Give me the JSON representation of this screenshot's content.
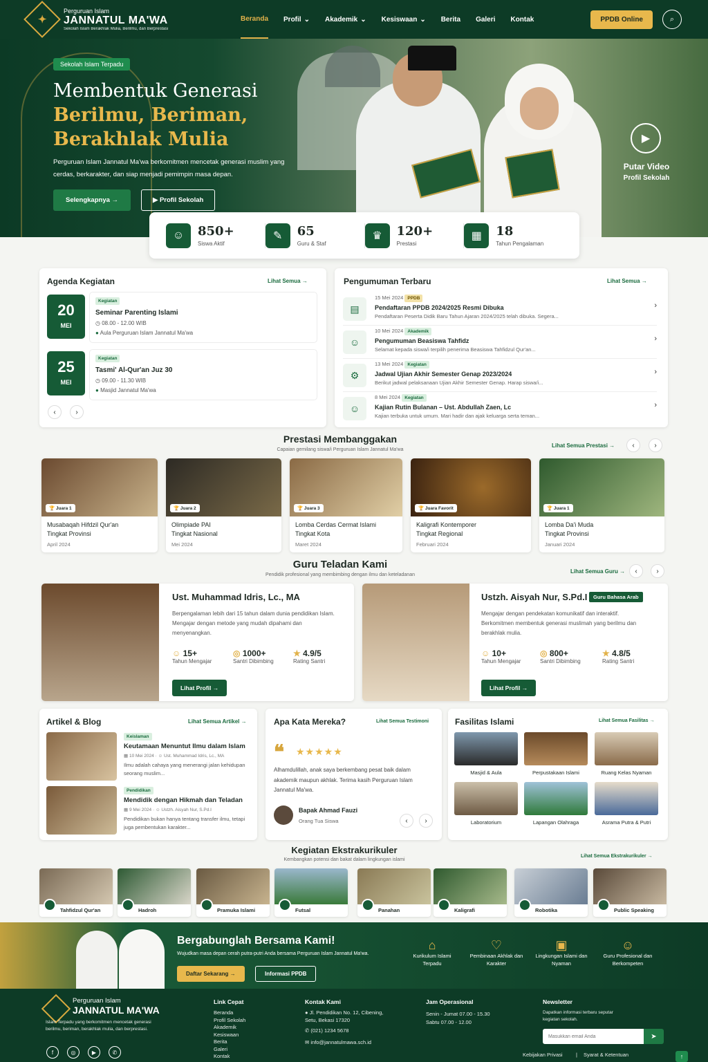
{
  "header": {
    "brand_top": "Perguruan Islam",
    "brand_name": "JANNATUL MA'WA",
    "brand_tagline": "Sekolah Islam Berakhlak Mulia, Berilmu, dan Berprestasi",
    "nav": [
      "Beranda",
      "Profil",
      "Akademik",
      "Kesiswaan",
      "Berita",
      "Galeri",
      "Kontak"
    ],
    "cta": "PPDB Online"
  },
  "hero": {
    "tag": "Sekolah Islam Terpadu",
    "line1": "Membentuk Generasi",
    "line2": "Berilmu, Beriman,",
    "line3": "Berakhlak Mulia",
    "desc": "Perguruan Islam Jannatul Ma'wa berkomitmen mencetak generasi muslim yang cerdas, berkarakter, dan siap menjadi pemimpin masa depan.",
    "btn_primary": "Selengkapnya",
    "btn_secondary": "Profil Sekolah",
    "video_title": "Putar Video",
    "video_sub": "Profil Sekolah"
  },
  "stats": [
    {
      "value": "850+",
      "label": "Siswa Aktif"
    },
    {
      "value": "65",
      "label": "Guru & Staf"
    },
    {
      "value": "120+",
      "label": "Prestasi"
    },
    {
      "value": "18",
      "label": "Tahun Pengalaman"
    }
  ],
  "agenda": {
    "title": "Agenda Kegiatan",
    "more": "Lihat Semua",
    "items": [
      {
        "day": "20",
        "month": "MEI",
        "badge": "Kegiatan",
        "title": "Seminar Parenting Islami",
        "time": "08.00 - 12.00 WIB",
        "place": "Aula Perguruan Islam Jannatul Ma'wa"
      },
      {
        "day": "25",
        "month": "MEI",
        "badge": "Kegiatan",
        "title": "Tasmi' Al-Qur'an Juz 30",
        "time": "09.00 - 11.30 WIB",
        "place": "Masjid Jannatul Ma'wa"
      }
    ]
  },
  "announcements": {
    "title": "Pengumuman Terbaru",
    "more": "Lihat Semua",
    "items": [
      {
        "date": "15 Mei 2024",
        "badge": "PPDB",
        "title": "Pendaftaran PPDB 2024/2025 Resmi Dibuka",
        "desc": "Pendaftaran Peserta Didik Baru Tahun Ajaran 2024/2025 telah dibuka. Segera..."
      },
      {
        "date": "10 Mei 2024",
        "badge": "Akademik",
        "title": "Pengumuman Beasiswa Tahfidz",
        "desc": "Selamat kepada siswa/i terpilih penerima Beasiswa Tahfidzul Qur'an..."
      },
      {
        "date": "13 Mei 2024",
        "badge": "Kegiatan",
        "title": "Jadwal Ujian Akhir Semester Genap 2023/2024",
        "desc": "Berikut jadwal pelaksanaan Ujian Akhir Semester Genap. Harap siswa/i..."
      },
      {
        "date": "8 Mei 2024",
        "badge": "Kegiatan",
        "title": "Kajian Rutin Bulanan – Ust. Abdullah Zaen, Lc",
        "desc": "Kajian terbuka untuk umum. Mari hadir dan ajak keluarga serta teman..."
      }
    ]
  },
  "prestasi": {
    "title": "Prestasi Membanggakan",
    "sub": "Capaian gemilang siswa/i Perguruan Islam Jannatul Ma'wa",
    "more": "Lihat Semua Prestasi",
    "items": [
      {
        "badge": "Juara 1",
        "title": "Musabaqah Hifdzil Qur'an",
        "level": "Tingkat Provinsi",
        "date": "April 2024"
      },
      {
        "badge": "Juara 2",
        "title": "Olimpiade PAI",
        "level": "Tingkat Nasional",
        "date": "Mei 2024"
      },
      {
        "badge": "Juara 3",
        "title": "Lomba Cerdas Cermat Islami",
        "level": "Tingkat Kota",
        "date": "Maret 2024"
      },
      {
        "badge": "Juara Favorit",
        "title": "Kaligrafi Kontemporer",
        "level": "Tingkat Regional",
        "date": "Februari 2024"
      },
      {
        "badge": "Juara 1",
        "title": "Lomba Da'i Muda",
        "level": "Tingkat Provinsi",
        "date": "Januari 2024"
      }
    ]
  },
  "guru": {
    "title": "Guru Teladan Kami",
    "sub": "Pendidik profesional yang membimbing dengan ilmu dan keteladanan",
    "more": "Lihat Semua Guru",
    "items": [
      {
        "name": "Ust. Muhammad Idris, Lc., MA",
        "desc": "Berpengalaman lebih dari 15 tahun dalam dunia pendidikan Islam. Mengajar dengan metode yang mudah dipahami dan menyenangkan.",
        "s1": "15+",
        "l1": "Tahun Mengajar",
        "s2": "1000+",
        "l2": "Santri Dibimbing",
        "s3": "4.9/5",
        "l3": "Rating Santri",
        "btn": "Lihat Profil"
      },
      {
        "name": "Ustzh. Aisyah Nur, S.Pd.I",
        "tag": "Guru Bahasa Arab",
        "desc": "Mengajar dengan pendekatan komunikatif dan interaktif. Berkomitmen membentuk generasi muslimah yang berilmu dan berakhlak mulia.",
        "s1": "10+",
        "l1": "Tahun Mengajar",
        "s2": "800+",
        "l2": "Santri Dibimbing",
        "s3": "4.8/5",
        "l3": "Rating Santri",
        "btn": "Lihat Profil"
      }
    ]
  },
  "artikel": {
    "title": "Artikel & Blog",
    "more": "Lihat Semua Artikel",
    "items": [
      {
        "badge": "Keislaman",
        "title": "Keutamaan Menuntut Ilmu dalam Islam",
        "date": "10 Mei 2024",
        "author": "Ust. Muhammad Idris, Lc., MA",
        "desc": "Ilmu adalah cahaya yang menerangi jalan kehidupan seorang muslim..."
      },
      {
        "badge": "Pendidikan",
        "title": "Mendidik dengan Hikmah dan Teladan",
        "date": "9 Mei 2024",
        "author": "Ustzh. Aisyah Nur, S.Pd.I",
        "desc": "Pendidikan bukan hanya tentang transfer ilmu, tetapi juga pembentukan karakter..."
      }
    ]
  },
  "testimoni": {
    "title": "Apa Kata Mereka?",
    "more": "Lihat Semua Testimoni",
    "rating": 5,
    "quote": "Alhamdulillah, anak saya berkembang pesat baik dalam akademik maupun akhlak. Terima kasih Perguruan Islam Jannatul Ma'wa.",
    "name": "Bapak Ahmad Fauzi",
    "role": "Orang Tua Siswa"
  },
  "fasilitas": {
    "title": "Fasilitas Islami",
    "more": "Lihat Semua Fasilitas",
    "items": [
      "Masjid & Aula",
      "Perpustakaan Islami",
      "Ruang Kelas Nyaman",
      "Laboratorium",
      "Lapangan Olahraga",
      "Asrama Putra & Putri"
    ]
  },
  "ekskul": {
    "title": "Kegiatan Ekstrakurikuler",
    "sub": "Kembangkan potensi dan bakat dalam lingkungan islami",
    "more": "Lihat Semua Ekstrakurikuler",
    "items": [
      "Tahfidzul Qur'an",
      "Hadroh",
      "Pramuka Islami",
      "Futsal",
      "Panahan",
      "Kaligrafi",
      "Robotika",
      "Public Speaking"
    ]
  },
  "cta": {
    "title": "Bergabunglah Bersama Kami!",
    "sub": "Wujudkan masa depan cerah putra-putri Anda bersama Perguruan Islam Jannatul Ma'wa.",
    "btn1": "Daftar Sekarang",
    "btn2": "Informasi PPDB",
    "features": [
      "Kurikulum Islami Terpadu",
      "Pembinaan Akhlak dan Karakter",
      "Lingkungan Islami dan Nyaman",
      "Guru Profesional dan Berkompeten"
    ]
  },
  "footer": {
    "brand_top": "Perguruan Islam",
    "brand_name": "JANNATUL MA'WA",
    "desc": "Islam Terpadu yang berkomitmen mencetak generasi berilmu, beriman, berakhlak mulia, dan berprestasi.",
    "links_title": "Link Cepat",
    "links": [
      "Beranda",
      "Profil Sekolah",
      "Akademik",
      "Kesiswaan",
      "Berita",
      "Galeri",
      "Kontak"
    ],
    "contact_title": "Kontak Kami",
    "address": "Jl. Pendidikan No. 12, Cibening, Setu, Bekasi 17320",
    "phone": "(021) 1234 5678",
    "email": "info@jannatulmawa.sch.id",
    "hours_title": "Jam Operasional",
    "hours1": "Senin - Jumat 07.00 - 15.30",
    "hours2": "Sabtu 07.00 - 12.00",
    "news_title": "Newsletter",
    "news_desc": "Dapatkan informasi terbaru seputar kegiatan sekolah.",
    "news_placeholder": "Masukkan email Anda",
    "privacy": "Kebijakan Privasi",
    "terms": "Syarat & Ketentuan"
  },
  "colors": {
    "primary": "#0d3b26",
    "accent": "#e8b84c",
    "green": "#165b36"
  }
}
